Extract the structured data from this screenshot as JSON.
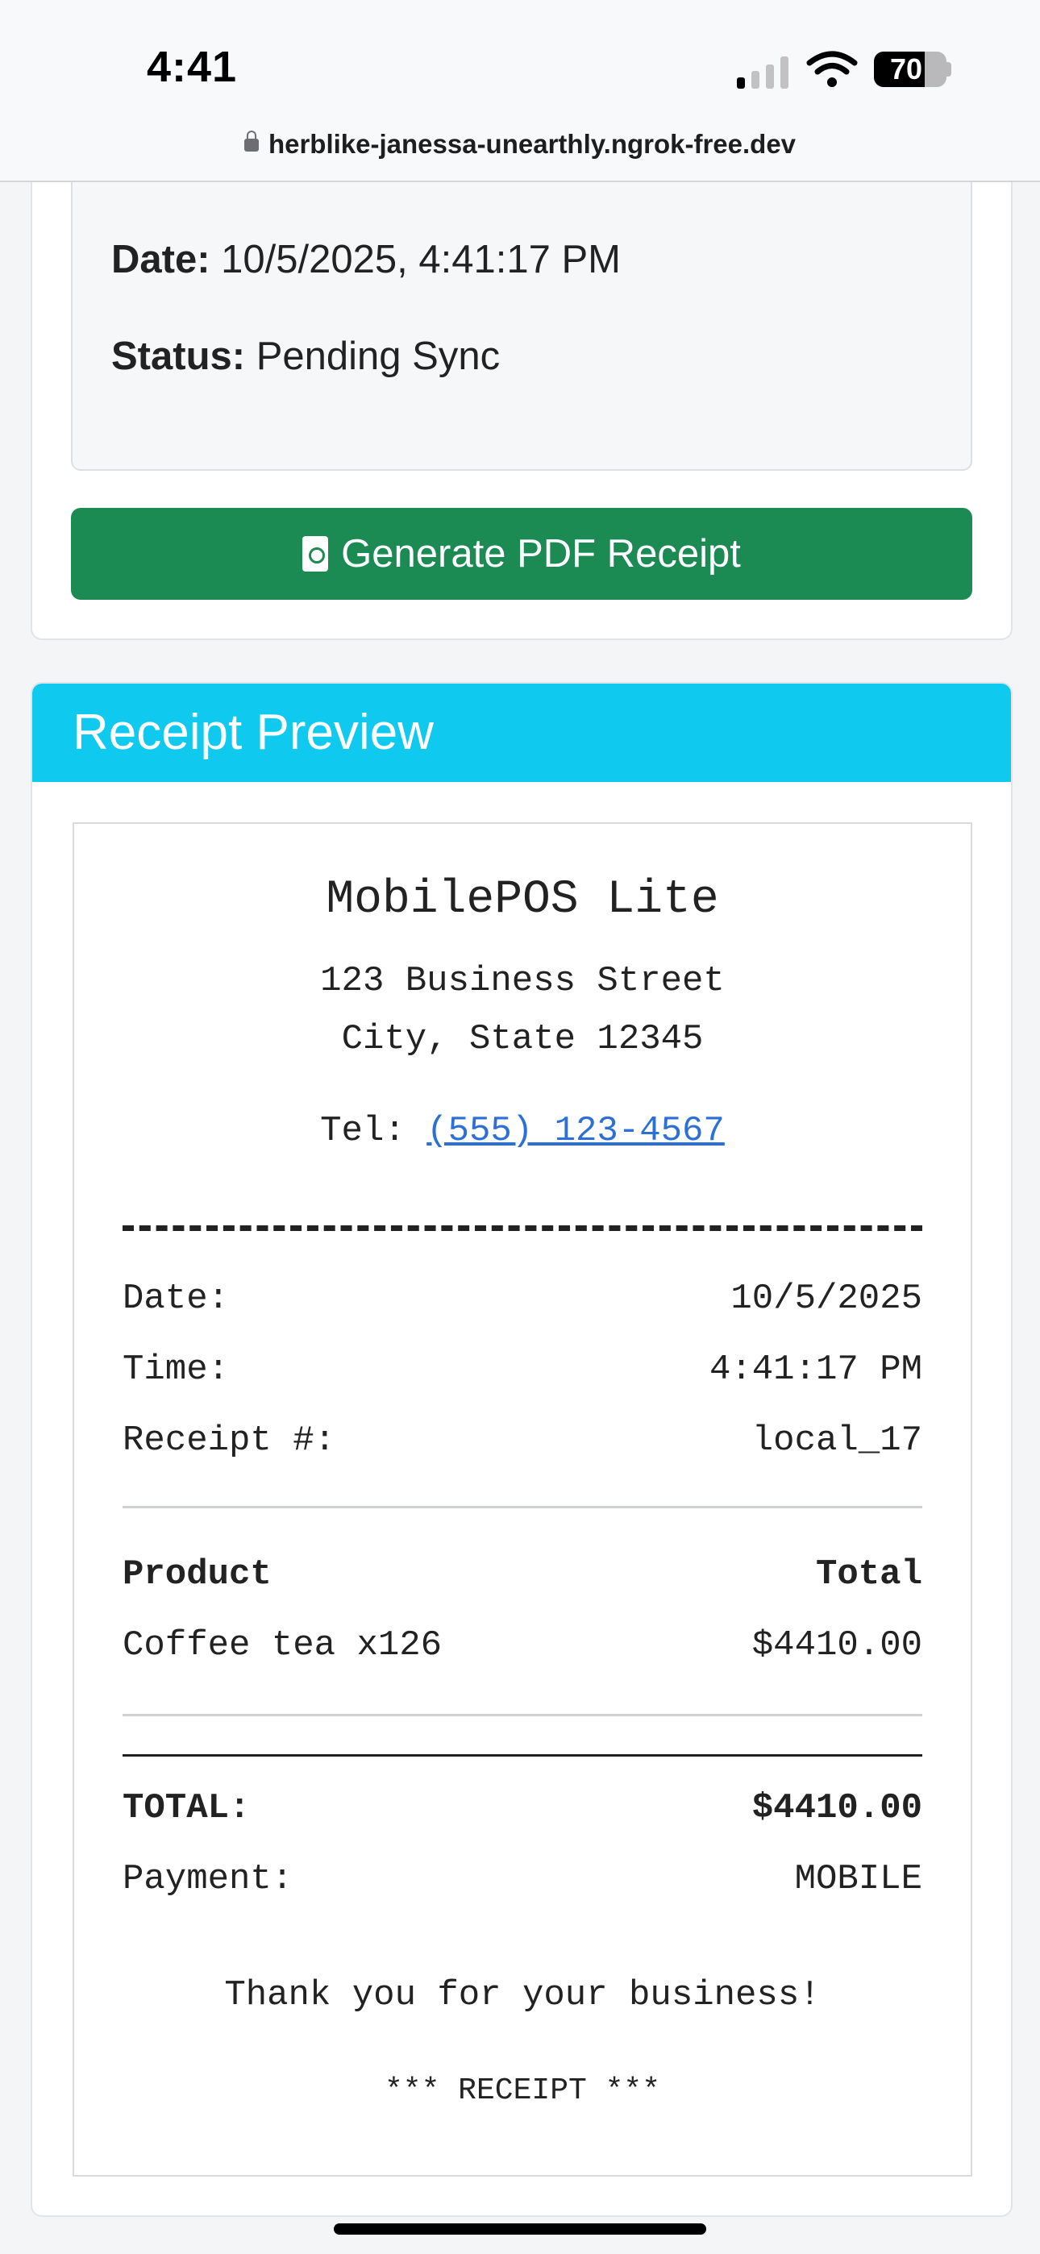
{
  "status_bar": {
    "time": "4:41",
    "battery": "70",
    "battery_level": 0.7,
    "url": "herblike-janessa-unearthly.ngrok-free.dev"
  },
  "transaction": {
    "date_label": "Date:",
    "date_value": "10/5/2025, 4:41:17 PM",
    "status_label": "Status:",
    "status_value": "Pending Sync",
    "generate_button": "Generate PDF Receipt"
  },
  "preview": {
    "header": "Receipt Preview",
    "store_name": "MobilePOS Lite",
    "address_line1": "123 Business Street",
    "address_line2": "City, State 12345",
    "tel_label": "Tel:",
    "tel_value": "(555) 123-4567",
    "meta": [
      {
        "label": "Date:",
        "value": "10/5/2025"
      },
      {
        "label": "Time:",
        "value": "4:41:17 PM"
      },
      {
        "label": "Receipt #:",
        "value": "local_17"
      }
    ],
    "columns": {
      "product": "Product",
      "total": "Total"
    },
    "items": [
      {
        "name": "Coffee tea x126",
        "total": "$4410.00"
      }
    ],
    "total_label": "TOTAL:",
    "total_value": "$4410.00",
    "payment_label": "Payment:",
    "payment_value": "MOBILE",
    "thanks": "Thank you for your business!",
    "footer": "*** RECEIPT ***"
  }
}
